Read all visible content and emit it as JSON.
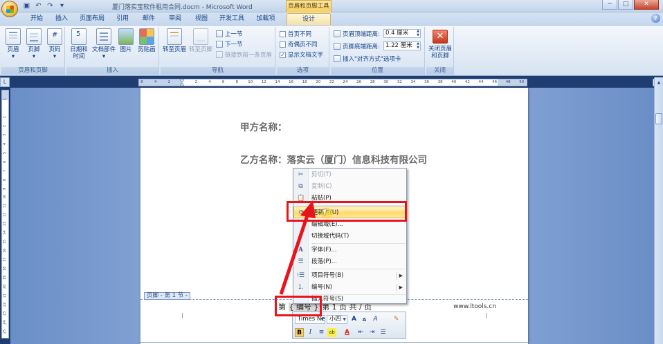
{
  "title_bar": {
    "doc_title": "厦门落实宝软件租用合同.docm - Microsoft Word",
    "context_tab_title": "页眉和页脚工具",
    "buttons": [
      "─",
      "□",
      "✕"
    ]
  },
  "ribbon_tabs": [
    "开始",
    "插入",
    "页面布局",
    "引用",
    "邮件",
    "审阅",
    "视图",
    "开发工具",
    "加载项",
    "设计"
  ],
  "ribbon": {
    "group_header_footer": {
      "label": "页眉和页脚",
      "header": "页眉",
      "footer": "页脚",
      "page_number": "页码"
    },
    "group_insert": {
      "label": "插入",
      "date_time_1": "日期和",
      "date_time_2": "时间",
      "quick_parts": "文档部件",
      "picture": "图片",
      "clip_art": "剪贴画"
    },
    "group_navigation": {
      "label": "导航",
      "goto_header": "转至页眉",
      "goto_footer": "转至页脚",
      "prev_section": "上一节",
      "next_section": "下一节",
      "link_previous": "链接到前一条页眉"
    },
    "group_options": {
      "label": "选项",
      "different_first": "首页不同",
      "odd_even": "奇偶页不同",
      "show_doc_text": "显示文档文字"
    },
    "group_position": {
      "label": "位置",
      "header_from_top_label": "页眉顶端距离:",
      "header_from_top_value": "0.4 厘米",
      "footer_from_bottom_label": "页脚底端距离:",
      "footer_from_bottom_value": "1.22 厘米",
      "insert_alignment_tab": "插入\"对齐方式\"选项卡"
    },
    "group_close": {
      "label": "关闭",
      "close_1": "关闭页眉",
      "close_2": "和页脚"
    }
  },
  "ruler": {
    "ticks": [
      "6",
      "4",
      "2",
      "",
      "2",
      "4",
      "6",
      "8",
      "10",
      "12",
      "14",
      "16",
      "18",
      "20",
      "22",
      "24",
      "26",
      "28",
      "30",
      "32",
      "34",
      "36",
      "38",
      "40",
      "42",
      "44",
      "46",
      "48",
      "50"
    ],
    "vticks": [
      "1",
      "",
      "1",
      "2",
      "3",
      "4",
      "5",
      "6",
      "7",
      "8",
      "9",
      "10",
      "11",
      "12",
      "13",
      "14",
      "15",
      "16",
      "17",
      "18",
      "19",
      "20",
      "21",
      "22",
      "23",
      "24",
      "25"
    ]
  },
  "document": {
    "party_a": "甲方名称：",
    "party_b": "乙方名称：落实云（厦门）信息科技有限公司",
    "footer_tag": "页脚 - 第 1 节 -",
    "footer_prefix": "第",
    "footer_field": "{ 编号 }",
    "footer_suffix": "第 1 页 共 / 页",
    "footer_url": "www.ltools.cn"
  },
  "context_menu": {
    "cut": "剪切(T)",
    "copy": "复制(C)",
    "paste": "粘贴(P)",
    "update_field": "更新域(U)",
    "edit_field": "编辑域(E)...",
    "toggle_codes": "切换域代码(T)",
    "font": "字体(F)...",
    "paragraph": "段落(P)...",
    "bullets": "项目符号(B)",
    "numbering": "编号(N)",
    "insert_symbol": "插入符号(S)"
  },
  "mini_toolbar": {
    "font_name": "Times Ne",
    "font_size": "小四",
    "grow": "A",
    "shrink": "A",
    "styles": "A",
    "format_painter": "✎",
    "bold": "B",
    "italic": "I",
    "center": "≡",
    "highlight": "ab",
    "font_color": "A",
    "indent_dec": "⇤",
    "indent_inc": "⇥",
    "bullets": "☰"
  },
  "colors": {
    "annotation_red": "#e8141a",
    "ribbon_text": "#15428b",
    "menu_highlight": "#ffd86a"
  }
}
